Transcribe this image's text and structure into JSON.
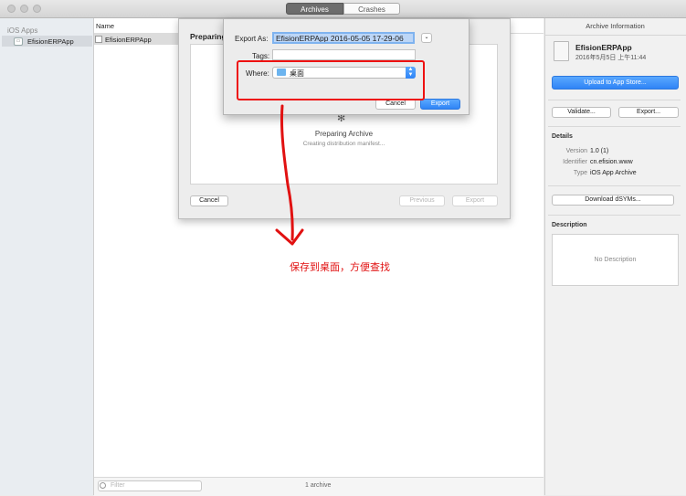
{
  "toolbar": {
    "tabs": [
      {
        "label": "Archives",
        "active": true
      },
      {
        "label": "Crashes",
        "active": false
      }
    ]
  },
  "sidebar": {
    "header": "iOS Apps",
    "items": [
      {
        "label": "EfisionERPApp",
        "selected": true
      }
    ]
  },
  "list": {
    "column_header": "Name",
    "rows": [
      {
        "name": "EfisionERPApp"
      }
    ],
    "filter_placeholder": "Filter",
    "count_label": "1 archive"
  },
  "distribution_sheet": {
    "title": "Preparing",
    "status_title": "Preparing Archive",
    "status_detail": "Creating distribution manifest...",
    "cancel_label": "Cancel",
    "previous_label": "Previous",
    "export_label": "Export"
  },
  "export_dialog": {
    "export_as_label": "Export As:",
    "export_as_value": "EfisionERPApp 2016-05-05 17-29-06",
    "tags_label": "Tags:",
    "tags_value": "",
    "where_label": "Where:",
    "where_value": "桌面",
    "cancel_label": "Cancel",
    "export_label": "Export"
  },
  "annotation": {
    "text": "保存到桌面，方便查找",
    "color": "#e11111"
  },
  "archive_info": {
    "title": "Archive Information",
    "app_name": "EfisionERPApp",
    "date": "2016年5月5日 上午11:44",
    "upload_label": "Upload to App Store...",
    "validate_label": "Validate...",
    "export_label": "Export...",
    "details_title": "Details",
    "details": [
      {
        "key": "Version",
        "value": "1.0 (1)"
      },
      {
        "key": "Identifier",
        "value": "cn.efision.www"
      },
      {
        "key": "Type",
        "value": "iOS App Archive"
      }
    ],
    "download_dsyms_label": "Download dSYMs...",
    "description_title": "Description",
    "description_placeholder": "No Description"
  },
  "colors": {
    "accent_blue": "#2f84f6",
    "annotation_red": "#e11111"
  }
}
